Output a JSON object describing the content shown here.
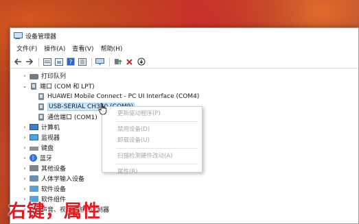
{
  "window": {
    "title": "设备管理器"
  },
  "menu": [
    "文件(F)",
    "操作(A)",
    "查看(V)",
    "帮助(H)"
  ],
  "toolbar": {
    "icons": [
      "back-icon",
      "forward-icon",
      "properties-icon",
      "refresh-icon",
      "help-icon",
      "show-hidden-icon",
      "monitor-icon",
      "update-driver-icon",
      "uninstall-icon",
      "download-icon"
    ]
  },
  "tree": {
    "printer_queue": "打印队列",
    "ports": "端口 (COM 和 LPT)",
    "port_children": [
      "HUAWEI Mobile Connect - PC UI Interface (COM4)",
      "USB-SERIAL CH340 (COM9)",
      "通信端口 (COM1)"
    ],
    "computer": "计算机",
    "monitors": "监视器",
    "keyboard": "键盘",
    "bluetooth": "蓝牙",
    "other_devices": "其他设备",
    "hid": "人体学输入设备",
    "software_devices": "软件设备",
    "software_components": "软件组件",
    "sound": "声音、视频和游戏控制器"
  },
  "context_menu": {
    "update_driver": "更新驱动程序(P)",
    "disable": "禁用设备(D)",
    "uninstall": "卸载设备(U)",
    "scan": "扫描检测硬件改动(A)",
    "properties": "属性(R)"
  },
  "caption": "右键，属性"
}
